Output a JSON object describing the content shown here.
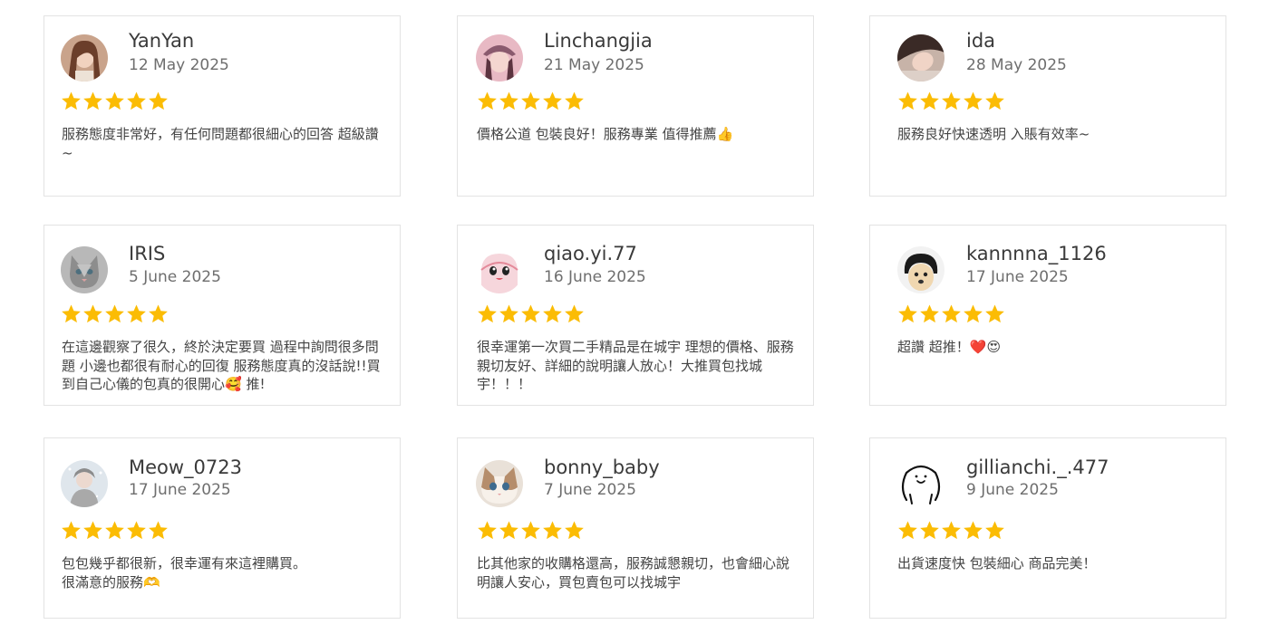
{
  "reviews": [
    {
      "name": "YanYan",
      "date": "12 May 2025",
      "rating": 5,
      "text": "服務態度非常好，有任何問題都很細心的回答 超級讚~",
      "avatar_icon": "woman-portrait-avatar"
    },
    {
      "name": "Linchangjia",
      "date": "21 May 2025",
      "rating": 5,
      "text": "價格公道 包裝良好！服務專業  值得推薦👍",
      "avatar_icon": "woman-hat-avatar"
    },
    {
      "name": "ida",
      "date": "28 May 2025",
      "rating": 5,
      "text": "服務良好快速透明 入賬有效率~",
      "avatar_icon": "woman-lying-avatar"
    },
    {
      "name": "IRIS",
      "date": "5 June 2025",
      "rating": 5,
      "text": "在這邊觀察了很久，終於決定要買 過程中詢問很多問題 小邊也都很有耐心的回復 服務態度真的沒話說!!買到自己心儀的包真的很開心🥰 推!",
      "avatar_icon": "cat-avatar"
    },
    {
      "name": "qiao.yi.77",
      "date": "16 June 2025",
      "rating": 5,
      "text": "很幸運第一次買二手精品是在城宇 理想的價格、服務親切友好、詳細的說明讓人放心！大推買包找城宇！！！",
      "avatar_icon": "cartoon-character-avatar"
    },
    {
      "name": "kannnna_1126",
      "date": "17 June 2025",
      "rating": 5,
      "text": "超讚 超推！❤️😍",
      "avatar_icon": "dog-avatar"
    },
    {
      "name": "Meow_0723",
      "date": "17 June 2025",
      "rating": 5,
      "text": "包包幾乎都很新，很幸運有來這裡購買。\n很滿意的服務🫶",
      "avatar_icon": "woman-snow-avatar"
    },
    {
      "name": "bonny_baby",
      "date": "7 June 2025",
      "rating": 5,
      "text": "比其他家的收購格還高，服務誠懇親切，也會細心說明讓人安心，買包賣包可以找城宇",
      "avatar_icon": "kitten-avatar"
    },
    {
      "name": "gillianchi._.477",
      "date": "9 June 2025",
      "rating": 5,
      "text": "出貨速度快 包裝細心 商品完美！",
      "avatar_icon": "doodle-face-avatar"
    }
  ],
  "colors": {
    "star": "#fbbc04",
    "border": "#e3e3e3",
    "name": "#3a3a3a",
    "date": "#6e6e6e",
    "text": "#444444"
  }
}
